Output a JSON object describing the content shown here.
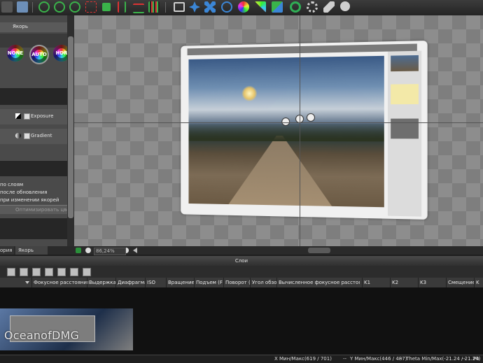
{
  "toolbar": {
    "icons": [
      "back-icon",
      "image-icon",
      "crosshair-icon",
      "crosshair-icon",
      "crosshair-icon",
      "grid-icon",
      "square-icon",
      "split-icon",
      "levels-icon",
      "bars-icon",
      "display-icon",
      "move-icon",
      "transform-icon",
      "target-icon",
      "auto-icon",
      "color-icon",
      "layers-icon",
      "refresh-icon",
      "settings-icon",
      "wrench-icon",
      "help-icon"
    ]
  },
  "left_panel": {
    "title": "Якорь",
    "presets": [
      "NONE",
      "AUTO",
      "HDR"
    ],
    "exposure_label": "Exposure",
    "gradient_label": "Gradient",
    "options": [
      "по слоям",
      "после обновления",
      "при изменении якорей"
    ],
    "optimize_button": "Оптимизировать цвета",
    "tabs": [
      "ория",
      "Якорь"
    ]
  },
  "zoom": {
    "value": "86,24%"
  },
  "layers": {
    "title": "Слои",
    "columns": [
      "Фокусное расстояния",
      "Выдержка",
      "Диафрагма",
      "ISO",
      "Вращение",
      "Подъем (F",
      "Поворот (I",
      "Угол обзо",
      "Вычисленное фокусное расстояние",
      "K1",
      "K2",
      "K3",
      "Смещение",
      "K"
    ]
  },
  "status": {
    "x": "X Мин/Макс(619 / 701)",
    "dash1": "--",
    "y": "Y Мин/Макс(446 / 487)",
    "dash2": "--",
    "theta": "Theta Min/Max(-21.24 / 21.24)",
    "dash3": "--",
    "phi": "Ph"
  },
  "watermark": "OceanofDMG",
  "colors": {
    "accent": "#2a8f3a",
    "canvas": "#8d8d8d"
  }
}
